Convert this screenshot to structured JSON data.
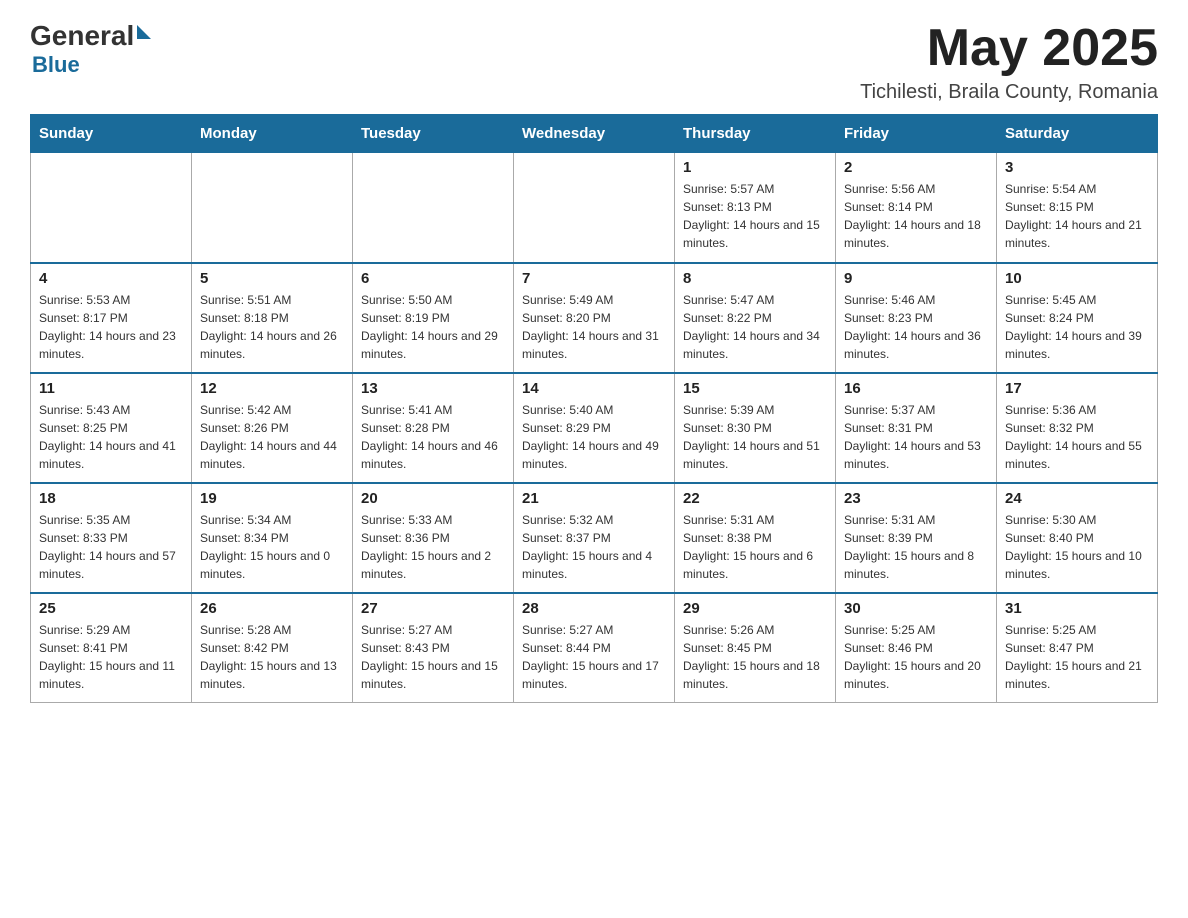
{
  "header": {
    "logo_general": "General",
    "logo_blue": "Blue",
    "month_title": "May 2025",
    "location": "Tichilesti, Braila County, Romania"
  },
  "days_of_week": [
    "Sunday",
    "Monday",
    "Tuesday",
    "Wednesday",
    "Thursday",
    "Friday",
    "Saturday"
  ],
  "weeks": [
    [
      {
        "day": "",
        "info": ""
      },
      {
        "day": "",
        "info": ""
      },
      {
        "day": "",
        "info": ""
      },
      {
        "day": "",
        "info": ""
      },
      {
        "day": "1",
        "info": "Sunrise: 5:57 AM\nSunset: 8:13 PM\nDaylight: 14 hours and 15 minutes."
      },
      {
        "day": "2",
        "info": "Sunrise: 5:56 AM\nSunset: 8:14 PM\nDaylight: 14 hours and 18 minutes."
      },
      {
        "day": "3",
        "info": "Sunrise: 5:54 AM\nSunset: 8:15 PM\nDaylight: 14 hours and 21 minutes."
      }
    ],
    [
      {
        "day": "4",
        "info": "Sunrise: 5:53 AM\nSunset: 8:17 PM\nDaylight: 14 hours and 23 minutes."
      },
      {
        "day": "5",
        "info": "Sunrise: 5:51 AM\nSunset: 8:18 PM\nDaylight: 14 hours and 26 minutes."
      },
      {
        "day": "6",
        "info": "Sunrise: 5:50 AM\nSunset: 8:19 PM\nDaylight: 14 hours and 29 minutes."
      },
      {
        "day": "7",
        "info": "Sunrise: 5:49 AM\nSunset: 8:20 PM\nDaylight: 14 hours and 31 minutes."
      },
      {
        "day": "8",
        "info": "Sunrise: 5:47 AM\nSunset: 8:22 PM\nDaylight: 14 hours and 34 minutes."
      },
      {
        "day": "9",
        "info": "Sunrise: 5:46 AM\nSunset: 8:23 PM\nDaylight: 14 hours and 36 minutes."
      },
      {
        "day": "10",
        "info": "Sunrise: 5:45 AM\nSunset: 8:24 PM\nDaylight: 14 hours and 39 minutes."
      }
    ],
    [
      {
        "day": "11",
        "info": "Sunrise: 5:43 AM\nSunset: 8:25 PM\nDaylight: 14 hours and 41 minutes."
      },
      {
        "day": "12",
        "info": "Sunrise: 5:42 AM\nSunset: 8:26 PM\nDaylight: 14 hours and 44 minutes."
      },
      {
        "day": "13",
        "info": "Sunrise: 5:41 AM\nSunset: 8:28 PM\nDaylight: 14 hours and 46 minutes."
      },
      {
        "day": "14",
        "info": "Sunrise: 5:40 AM\nSunset: 8:29 PM\nDaylight: 14 hours and 49 minutes."
      },
      {
        "day": "15",
        "info": "Sunrise: 5:39 AM\nSunset: 8:30 PM\nDaylight: 14 hours and 51 minutes."
      },
      {
        "day": "16",
        "info": "Sunrise: 5:37 AM\nSunset: 8:31 PM\nDaylight: 14 hours and 53 minutes."
      },
      {
        "day": "17",
        "info": "Sunrise: 5:36 AM\nSunset: 8:32 PM\nDaylight: 14 hours and 55 minutes."
      }
    ],
    [
      {
        "day": "18",
        "info": "Sunrise: 5:35 AM\nSunset: 8:33 PM\nDaylight: 14 hours and 57 minutes."
      },
      {
        "day": "19",
        "info": "Sunrise: 5:34 AM\nSunset: 8:34 PM\nDaylight: 15 hours and 0 minutes."
      },
      {
        "day": "20",
        "info": "Sunrise: 5:33 AM\nSunset: 8:36 PM\nDaylight: 15 hours and 2 minutes."
      },
      {
        "day": "21",
        "info": "Sunrise: 5:32 AM\nSunset: 8:37 PM\nDaylight: 15 hours and 4 minutes."
      },
      {
        "day": "22",
        "info": "Sunrise: 5:31 AM\nSunset: 8:38 PM\nDaylight: 15 hours and 6 minutes."
      },
      {
        "day": "23",
        "info": "Sunrise: 5:31 AM\nSunset: 8:39 PM\nDaylight: 15 hours and 8 minutes."
      },
      {
        "day": "24",
        "info": "Sunrise: 5:30 AM\nSunset: 8:40 PM\nDaylight: 15 hours and 10 minutes."
      }
    ],
    [
      {
        "day": "25",
        "info": "Sunrise: 5:29 AM\nSunset: 8:41 PM\nDaylight: 15 hours and 11 minutes."
      },
      {
        "day": "26",
        "info": "Sunrise: 5:28 AM\nSunset: 8:42 PM\nDaylight: 15 hours and 13 minutes."
      },
      {
        "day": "27",
        "info": "Sunrise: 5:27 AM\nSunset: 8:43 PM\nDaylight: 15 hours and 15 minutes."
      },
      {
        "day": "28",
        "info": "Sunrise: 5:27 AM\nSunset: 8:44 PM\nDaylight: 15 hours and 17 minutes."
      },
      {
        "day": "29",
        "info": "Sunrise: 5:26 AM\nSunset: 8:45 PM\nDaylight: 15 hours and 18 minutes."
      },
      {
        "day": "30",
        "info": "Sunrise: 5:25 AM\nSunset: 8:46 PM\nDaylight: 15 hours and 20 minutes."
      },
      {
        "day": "31",
        "info": "Sunrise: 5:25 AM\nSunset: 8:47 PM\nDaylight: 15 hours and 21 minutes."
      }
    ]
  ]
}
